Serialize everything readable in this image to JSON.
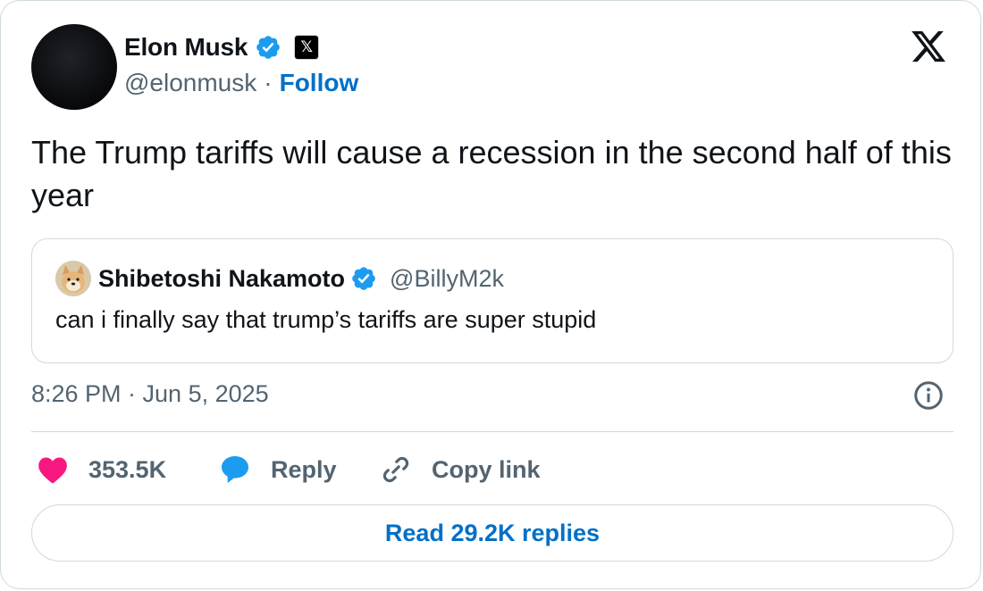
{
  "author": {
    "name": "Elon Musk",
    "handle": "@elonmusk",
    "separator": "·",
    "follow_label": "Follow",
    "affiliation_badge": "𝕏"
  },
  "icons": {
    "verified": "verified-badge-icon",
    "x_logo": "x-logo-icon",
    "info": "info-icon",
    "like": "heart-icon",
    "reply": "reply-bubble-icon",
    "copy": "link-icon"
  },
  "tweet": {
    "text": "The Trump tariffs will cause a recession in the second half of this year",
    "timestamp": "8:26 PM · Jun 5, 2025"
  },
  "quoted": {
    "name": "Shibetoshi Nakamoto",
    "handle": "@BillyM2k",
    "text": "can i finally say that trump’s tariffs are super stupid"
  },
  "actions": {
    "likes": "353.5K",
    "reply_label": "Reply",
    "copy_label": "Copy link"
  },
  "read_replies_label": "Read 29.2K replies",
  "colors": {
    "accent": "#0070c9",
    "verified": "#1d9bf0",
    "like": "#f91880",
    "text": "#0f1419",
    "secondary": "#536471",
    "border": "#cfd9de"
  }
}
